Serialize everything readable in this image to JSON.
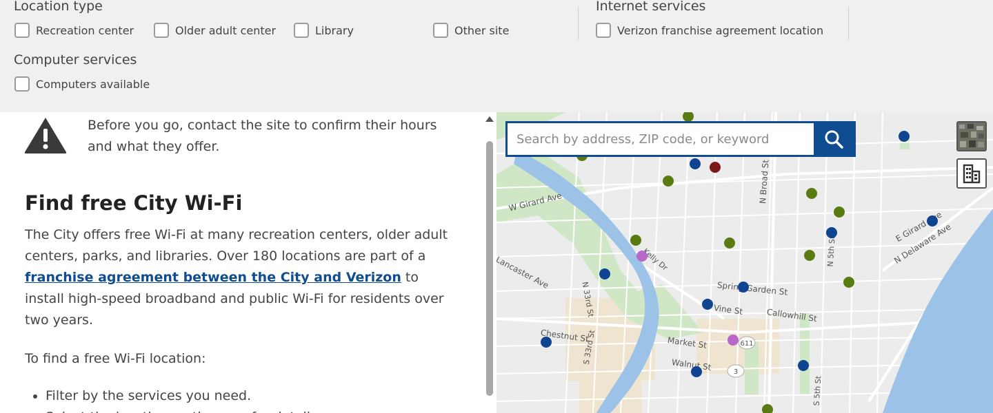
{
  "filters": {
    "location_type": {
      "label": "Location type",
      "options": [
        "Recreation center",
        "Older adult center",
        "Library",
        "Other site"
      ]
    },
    "internet_services": {
      "label": "Internet services",
      "options": [
        "Verizon franchise agreement location"
      ]
    },
    "computer_services": {
      "label": "Computer services",
      "options": [
        "Computers available"
      ]
    }
  },
  "info": {
    "notice": "Before you go, contact the site to confirm their hours and what they offer.",
    "heading": "Find free City Wi-Fi",
    "para_before_link": "The City offers free Wi-Fi at many recreation centers, older adult centers, parks, and libraries. Over 180 locations are part of a ",
    "link_text": "franchise agreement between the City and Verizon",
    "para_after_link": " to install high-speed broadband and public Wi-Fi for residents over two years.",
    "para2": "To find a free Wi-Fi location:",
    "steps": [
      "Filter by the services you need.",
      "Select the location on the map for details."
    ]
  },
  "search": {
    "placeholder": "Search by address, ZIP code, or keyword"
  },
  "map": {
    "streets": {
      "w_girard": "W Girard Ave",
      "e_girard": "E Girard Ave",
      "n_delaware": "N Delaware Ave",
      "lancaster": "Lancaster Ave",
      "n_broad": "N Broad St",
      "n_5th": "N 5th St",
      "spring_garden": "Spring Garden St",
      "callowhill": "Callowhill St",
      "vine": "Vine St",
      "market": "Market St",
      "chestnut": "Chestnut St",
      "walnut": "Walnut St",
      "s_33rd": "S 33rd St",
      "n_33rd": "N 33rd St",
      "kelly": "Kelly Dr",
      "s_5th": "S 5th St"
    },
    "route_shields": [
      "611",
      "3"
    ],
    "colors": {
      "recreation": "#5a7a12",
      "library": "#0f4491",
      "older_adult": "#b768c9",
      "other": "#7b1818"
    }
  }
}
